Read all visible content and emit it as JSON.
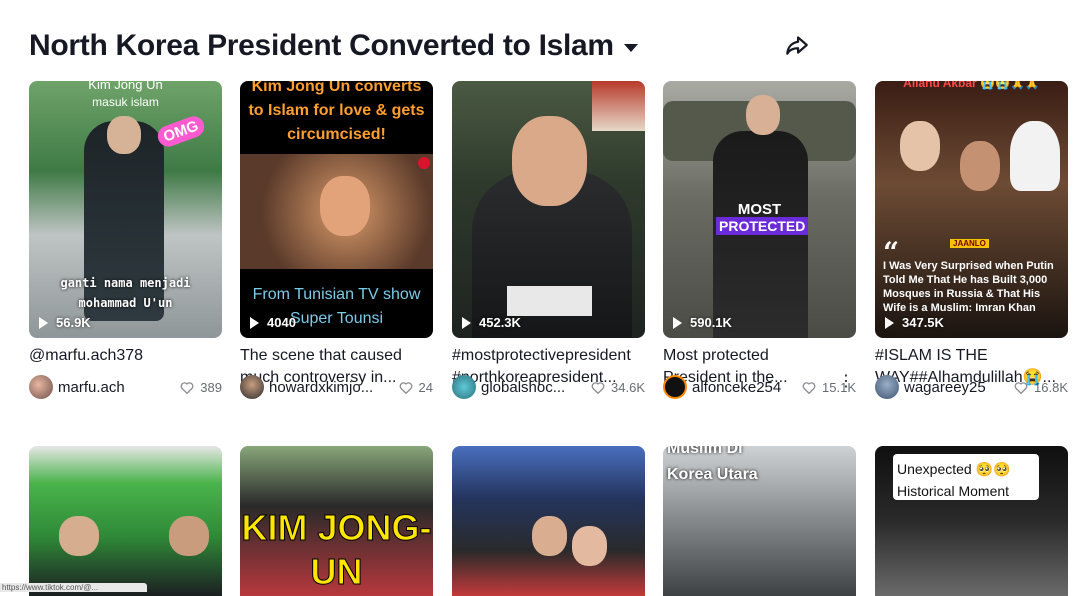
{
  "header": {
    "title": "North Korea President Converted to Islam"
  },
  "cards": [
    {
      "views": "56.9K",
      "desc": "@marfu.ach378",
      "user": "marfu.ach",
      "likes": "389",
      "overlay_top": "Kim Jong Un",
      "overlay_sub": "masuk islam",
      "overlay_bottom": "ganti nama menjadi mohammad U'un",
      "sticker": "OMG"
    },
    {
      "views": "4040",
      "desc": "The scene that caused much controversy in...",
      "user": "howardxkimjo...",
      "likes": "24",
      "overlay_top": "Kim Jong Un converts to Islam for love & gets circumcised!",
      "overlay_bottom": "From Tunisian TV show Super Tounsi"
    },
    {
      "views": "452.3K",
      "desc": "#mostprotectivepresident #northkoreapresident...",
      "user": "globalshoc...",
      "likes": "34.6K"
    },
    {
      "views": "590.1K",
      "desc": "Most protected President in the...",
      "user": "alfonceke254",
      "likes": "15.1K",
      "overlay_label1": "MOST",
      "overlay_label2": "PROTECTED"
    },
    {
      "views": "347.5K",
      "desc": "#ISLAM IS THE WAY##Alhamdulillah😭...",
      "user": "wagareey25",
      "likes": "16.8K",
      "overlay_top": "Allahu Akbar 😭😭🙏🙏",
      "overlay_brand": "JAANLO",
      "overlay_quote": "I Was Very Surprised when Putin Told Me That He has Built 3,000 Mosques in Russia & That His Wife is a Muslim: Imran Khan"
    }
  ],
  "row2": [
    {
      "overlay": ""
    },
    {
      "overlay": "KIM JONG-UN"
    },
    {
      "overlay": ""
    },
    {
      "overlay": "Muslim Di Korea Utara"
    },
    {
      "overlay": "Unexpected 🥺🥺 Historical Moment"
    }
  ],
  "status_url": "https://www.tiktok.com/@... /video/7301113491411980493",
  "colors": {
    "text": "#161823",
    "muted": "#8a8b91",
    "accent_purple": "#6b2bd9",
    "overlay_orange": "#ff9f2e"
  }
}
